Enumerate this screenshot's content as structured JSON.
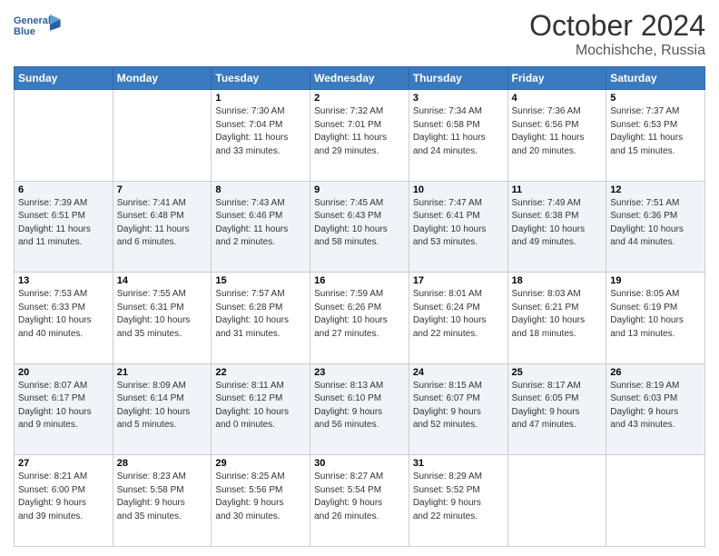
{
  "header": {
    "logo_line1": "General",
    "logo_line2": "Blue",
    "month": "October 2024",
    "location": "Mochishche, Russia"
  },
  "weekdays": [
    "Sunday",
    "Monday",
    "Tuesday",
    "Wednesday",
    "Thursday",
    "Friday",
    "Saturday"
  ],
  "weeks": [
    [
      {
        "day": "",
        "info": ""
      },
      {
        "day": "",
        "info": ""
      },
      {
        "day": "1",
        "info": "Sunrise: 7:30 AM\nSunset: 7:04 PM\nDaylight: 11 hours\nand 33 minutes."
      },
      {
        "day": "2",
        "info": "Sunrise: 7:32 AM\nSunset: 7:01 PM\nDaylight: 11 hours\nand 29 minutes."
      },
      {
        "day": "3",
        "info": "Sunrise: 7:34 AM\nSunset: 6:58 PM\nDaylight: 11 hours\nand 24 minutes."
      },
      {
        "day": "4",
        "info": "Sunrise: 7:36 AM\nSunset: 6:56 PM\nDaylight: 11 hours\nand 20 minutes."
      },
      {
        "day": "5",
        "info": "Sunrise: 7:37 AM\nSunset: 6:53 PM\nDaylight: 11 hours\nand 15 minutes."
      }
    ],
    [
      {
        "day": "6",
        "info": "Sunrise: 7:39 AM\nSunset: 6:51 PM\nDaylight: 11 hours\nand 11 minutes."
      },
      {
        "day": "7",
        "info": "Sunrise: 7:41 AM\nSunset: 6:48 PM\nDaylight: 11 hours\nand 6 minutes."
      },
      {
        "day": "8",
        "info": "Sunrise: 7:43 AM\nSunset: 6:46 PM\nDaylight: 11 hours\nand 2 minutes."
      },
      {
        "day": "9",
        "info": "Sunrise: 7:45 AM\nSunset: 6:43 PM\nDaylight: 10 hours\nand 58 minutes."
      },
      {
        "day": "10",
        "info": "Sunrise: 7:47 AM\nSunset: 6:41 PM\nDaylight: 10 hours\nand 53 minutes."
      },
      {
        "day": "11",
        "info": "Sunrise: 7:49 AM\nSunset: 6:38 PM\nDaylight: 10 hours\nand 49 minutes."
      },
      {
        "day": "12",
        "info": "Sunrise: 7:51 AM\nSunset: 6:36 PM\nDaylight: 10 hours\nand 44 minutes."
      }
    ],
    [
      {
        "day": "13",
        "info": "Sunrise: 7:53 AM\nSunset: 6:33 PM\nDaylight: 10 hours\nand 40 minutes."
      },
      {
        "day": "14",
        "info": "Sunrise: 7:55 AM\nSunset: 6:31 PM\nDaylight: 10 hours\nand 35 minutes."
      },
      {
        "day": "15",
        "info": "Sunrise: 7:57 AM\nSunset: 6:28 PM\nDaylight: 10 hours\nand 31 minutes."
      },
      {
        "day": "16",
        "info": "Sunrise: 7:59 AM\nSunset: 6:26 PM\nDaylight: 10 hours\nand 27 minutes."
      },
      {
        "day": "17",
        "info": "Sunrise: 8:01 AM\nSunset: 6:24 PM\nDaylight: 10 hours\nand 22 minutes."
      },
      {
        "day": "18",
        "info": "Sunrise: 8:03 AM\nSunset: 6:21 PM\nDaylight: 10 hours\nand 18 minutes."
      },
      {
        "day": "19",
        "info": "Sunrise: 8:05 AM\nSunset: 6:19 PM\nDaylight: 10 hours\nand 13 minutes."
      }
    ],
    [
      {
        "day": "20",
        "info": "Sunrise: 8:07 AM\nSunset: 6:17 PM\nDaylight: 10 hours\nand 9 minutes."
      },
      {
        "day": "21",
        "info": "Sunrise: 8:09 AM\nSunset: 6:14 PM\nDaylight: 10 hours\nand 5 minutes."
      },
      {
        "day": "22",
        "info": "Sunrise: 8:11 AM\nSunset: 6:12 PM\nDaylight: 10 hours\nand 0 minutes."
      },
      {
        "day": "23",
        "info": "Sunrise: 8:13 AM\nSunset: 6:10 PM\nDaylight: 9 hours\nand 56 minutes."
      },
      {
        "day": "24",
        "info": "Sunrise: 8:15 AM\nSunset: 6:07 PM\nDaylight: 9 hours\nand 52 minutes."
      },
      {
        "day": "25",
        "info": "Sunrise: 8:17 AM\nSunset: 6:05 PM\nDaylight: 9 hours\nand 47 minutes."
      },
      {
        "day": "26",
        "info": "Sunrise: 8:19 AM\nSunset: 6:03 PM\nDaylight: 9 hours\nand 43 minutes."
      }
    ],
    [
      {
        "day": "27",
        "info": "Sunrise: 8:21 AM\nSunset: 6:00 PM\nDaylight: 9 hours\nand 39 minutes."
      },
      {
        "day": "28",
        "info": "Sunrise: 8:23 AM\nSunset: 5:58 PM\nDaylight: 9 hours\nand 35 minutes."
      },
      {
        "day": "29",
        "info": "Sunrise: 8:25 AM\nSunset: 5:56 PM\nDaylight: 9 hours\nand 30 minutes."
      },
      {
        "day": "30",
        "info": "Sunrise: 8:27 AM\nSunset: 5:54 PM\nDaylight: 9 hours\nand 26 minutes."
      },
      {
        "day": "31",
        "info": "Sunrise: 8:29 AM\nSunset: 5:52 PM\nDaylight: 9 hours\nand 22 minutes."
      },
      {
        "day": "",
        "info": ""
      },
      {
        "day": "",
        "info": ""
      }
    ]
  ]
}
